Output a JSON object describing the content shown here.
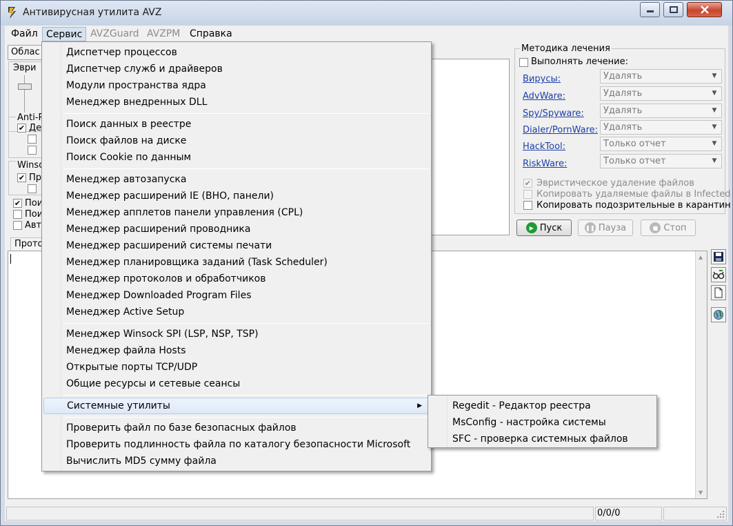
{
  "window": {
    "title": "Антивирусная утилита AVZ"
  },
  "menubar": {
    "items": [
      "Файл",
      "Сервис",
      "AVZGuard",
      "AVZPM",
      "Справка"
    ]
  },
  "left_panel": {
    "tab_label": "Облас",
    "heuristic_label": "Эври",
    "anti_label": "Anti-P",
    "anti_first": "Де",
    "winsock_label": "Winso",
    "winsock_first": "Пр",
    "search_items": [
      "Пои",
      "Пои",
      "Авт"
    ]
  },
  "treatment": {
    "title": "Методика лечения",
    "perform_label": "Выполнять лечение:",
    "rows": [
      {
        "name": "Вирусы:",
        "value": "Удалять"
      },
      {
        "name": "AdvWare:",
        "value": "Удалять"
      },
      {
        "name": "Spy/Spyware:",
        "value": "Удалять"
      },
      {
        "name": "Dialer/PornWare:",
        "value": "Удалять"
      },
      {
        "name": "HackTool:",
        "value": "Только отчет"
      },
      {
        "name": "RiskWare:",
        "value": "Только отчет"
      }
    ],
    "options": [
      "Эвристическое удаление файлов",
      "Копировать удаляемые файлы в  Infected",
      "Копировать подозрительные в  карантин"
    ]
  },
  "controls": {
    "start": "Пуск",
    "pause": "Пауза",
    "stop": "Стоп"
  },
  "log": {
    "tab_label": "Прото"
  },
  "status": {
    "counter": "0/0/0"
  },
  "service_menu": {
    "items": [
      "Диспетчер процессов",
      "Диспетчер служб и драйверов",
      "Модули пространства ядра",
      "Менеджер внедренных DLL",
      "Поиск данных  в реестре",
      "Поиск файлов на диске",
      "Поиск Cookie по данным",
      "Менеджер автозапуска",
      "Менеджер расширений IE (BHO, панели)",
      "Менеджер апплетов панели управления (CPL)",
      "Менеджер расширений проводника",
      "Менеджер расширений системы печати",
      "Менеджер планировщика заданий (Task Scheduler)",
      "Менеджер протоколов и обработчиков",
      "Менеджер Downloaded Program Files",
      "Менеджер Active Setup",
      "Менеджер Winsock SPI (LSP, NSP, TSP)",
      "Менеджер файла Hosts",
      "Открытые порты TCP/UDP",
      "Общие ресурсы и сетевые сеансы",
      "Системные утилиты",
      "Проверить файл по базе безопасных файлов",
      "Проверить подлинность файла по каталогу безопасности Microsoft",
      "Вычислить MD5 сумму файла"
    ]
  },
  "system_utils_menu": {
    "items": [
      "Regedit - Редактор реестра",
      "MsConfig - настройка системы",
      "SFC - проверка системных файлов"
    ]
  }
}
